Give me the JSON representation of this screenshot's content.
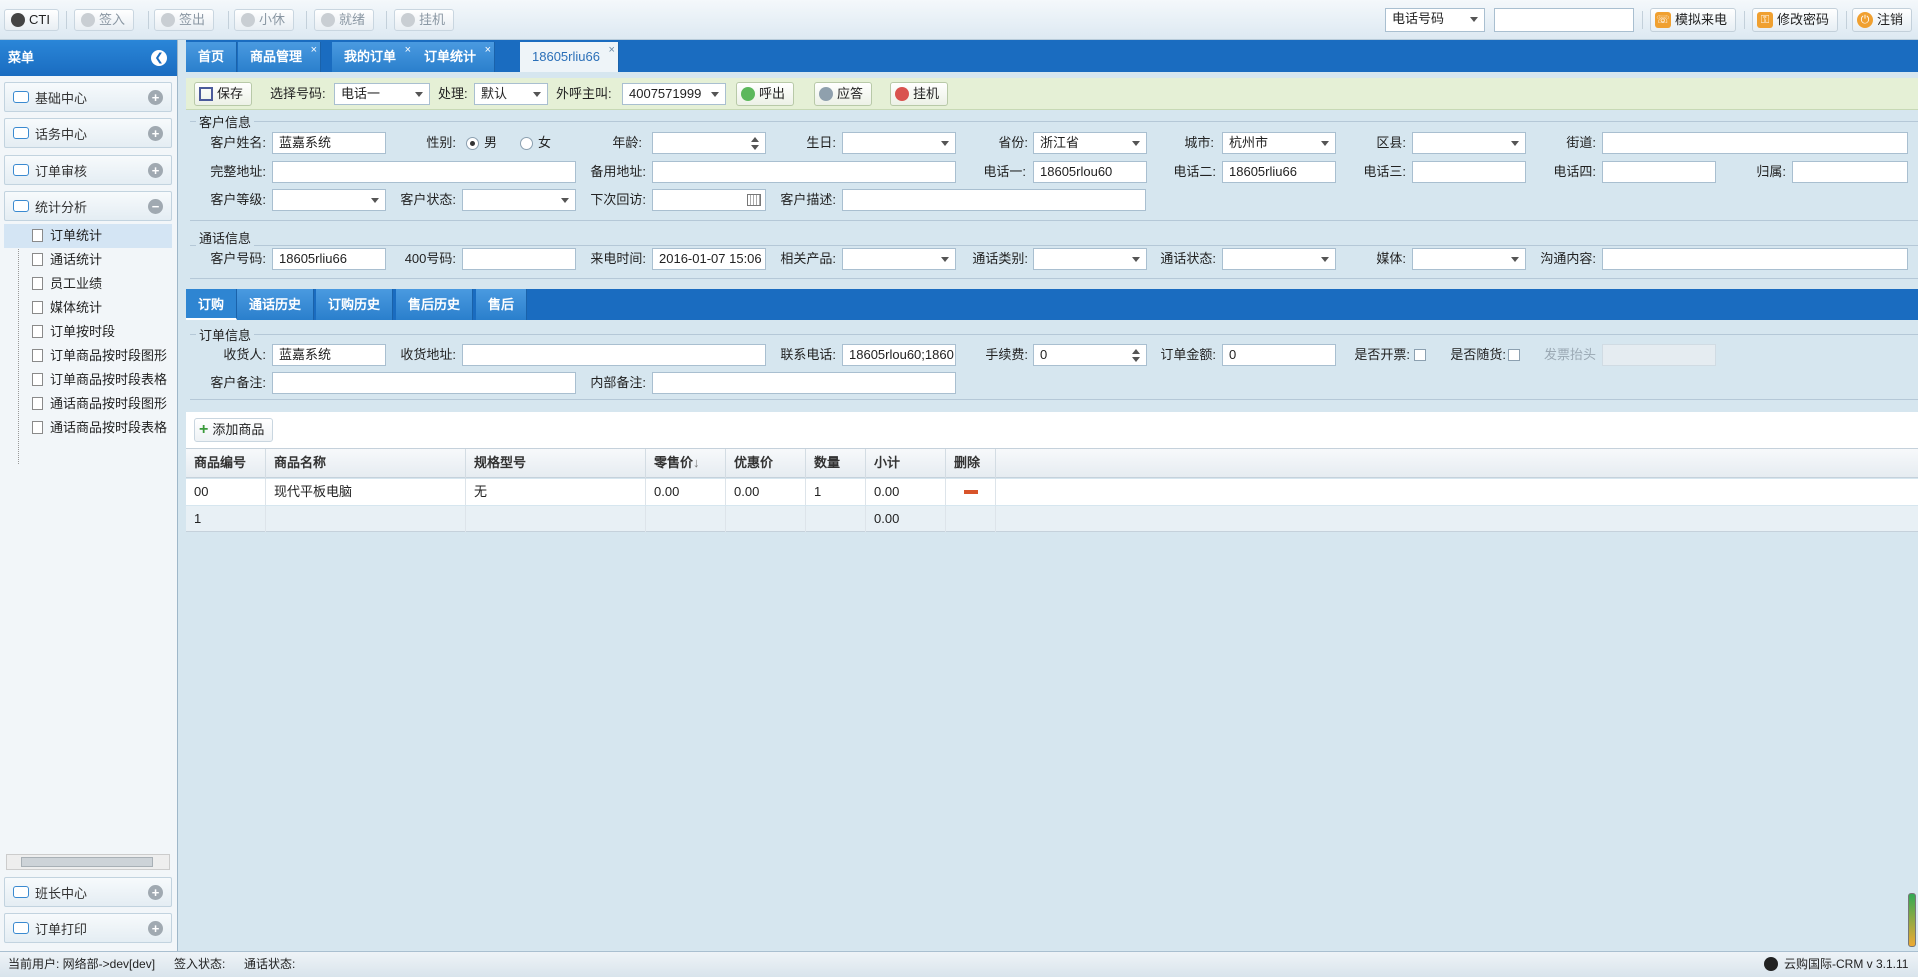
{
  "topbar": {
    "cti": "CTI",
    "sign_in": "签入",
    "sign_out": "签出",
    "rest": "小休",
    "ready": "就绪",
    "hangup": "挂机",
    "phone_select": "电话号码",
    "phone_input": "",
    "simulate_call": "模拟来电",
    "change_password": "修改密码",
    "logout": "注销"
  },
  "sidebar": {
    "title": "菜单",
    "sections": {
      "basic": "基础中心",
      "calls": "话务中心",
      "order_review": "订单审核",
      "stats": "统计分析",
      "team_lead": "班长中心",
      "order_print": "订单打印"
    },
    "tree": [
      "订单统计",
      "通话统计",
      "员工业绩",
      "媒体统计",
      "订单按时段",
      "订单商品按时段图形",
      "订单商品按时段表格",
      "通话商品按时段图形",
      "通话商品按时段表格"
    ]
  },
  "tabs": [
    "首页",
    "商品管理",
    "我的订单",
    "订单统计",
    "18605rliu66"
  ],
  "actions": {
    "save": "保存",
    "select_number_label": "选择号码:",
    "select_number_value": "电话一",
    "handle_label": "处理:",
    "handle_value": "默认",
    "outbound_label": "外呼主叫:",
    "outbound_value": "4007571999",
    "call_out": "呼出",
    "answer": "应答",
    "hangup": "挂机"
  },
  "customer": {
    "legend": "客户信息",
    "name_label": "客户姓名:",
    "name": "蓝嘉系统",
    "gender_label": "性别:",
    "male": "男",
    "female": "女",
    "age_label": "年龄:",
    "age": "",
    "birthday_label": "生日:",
    "birthday": "",
    "province_label": "省份:",
    "province": "浙江省",
    "city_label": "城市:",
    "city": "杭州市",
    "district_label": "区县:",
    "district": "",
    "street_label": "街道:",
    "street": "",
    "address_label": "完整地址:",
    "address": "",
    "alt_address_label": "备用地址:",
    "alt_address": "",
    "phone1_label": "电话一:",
    "phone1": "18605rlou60",
    "phone2_label": "电话二:",
    "phone2": "18605rliu66",
    "phone3_label": "电话三:",
    "phone3": "",
    "phone4_label": "电话四:",
    "phone4": "",
    "owner_label": "归属:",
    "owner": "",
    "level_label": "客户等级:",
    "level": "",
    "status_label": "客户状态:",
    "status": "",
    "next_visit_label": "下次回访:",
    "next_visit": "",
    "desc_label": "客户描述:",
    "desc": ""
  },
  "call": {
    "legend": "通话信息",
    "number_label": "客户号码:",
    "number": "18605rliu66",
    "n400_label": "400号码:",
    "n400": "",
    "time_label": "来电时间:",
    "time": "2016-01-07 15:06",
    "product_label": "相关产品:",
    "product": "",
    "type_label": "通话类别:",
    "type": "",
    "state_label": "通话状态:",
    "state": "",
    "media_label": "媒体:",
    "media": "",
    "content_label": "沟通内容:",
    "content": ""
  },
  "subtabs": [
    "订购",
    "通话历史",
    "订购历史",
    "售后历史",
    "售后"
  ],
  "order": {
    "legend": "订单信息",
    "receiver_label": "收货人:",
    "receiver": "蓝嘉系统",
    "ship_addr_label": "收货地址:",
    "ship_addr": "",
    "contact_label": "联系电话:",
    "contact": "18605rlou60;1860",
    "fee_label": "手续费:",
    "fee": "0",
    "amount_label": "订单金额:",
    "amount": "0",
    "invoice_label": "是否开票:",
    "with_goods_label": "是否随货:",
    "invoice_title_label": "发票抬头",
    "cust_note_label": "客户备注:",
    "cust_note": "",
    "inner_note_label": "内部备注:",
    "inner_note": "",
    "add_product": "添加商品"
  },
  "grid": {
    "headers": [
      "商品编号",
      "商品名称",
      "规格型号",
      "零售价",
      "优惠价",
      "数量",
      "小计",
      "删除"
    ],
    "rows": [
      [
        "00",
        "现代平板电脑",
        "无",
        "0.00",
        "0.00",
        "1",
        "0.00"
      ]
    ],
    "footer": [
      "1",
      "0.00"
    ]
  },
  "status": {
    "user": "当前用户: 网络部->dev[dev]",
    "sign_state": "签入状态:",
    "call_state": "通话状态:",
    "version": "云购国际-CRM v 3.1.11"
  }
}
